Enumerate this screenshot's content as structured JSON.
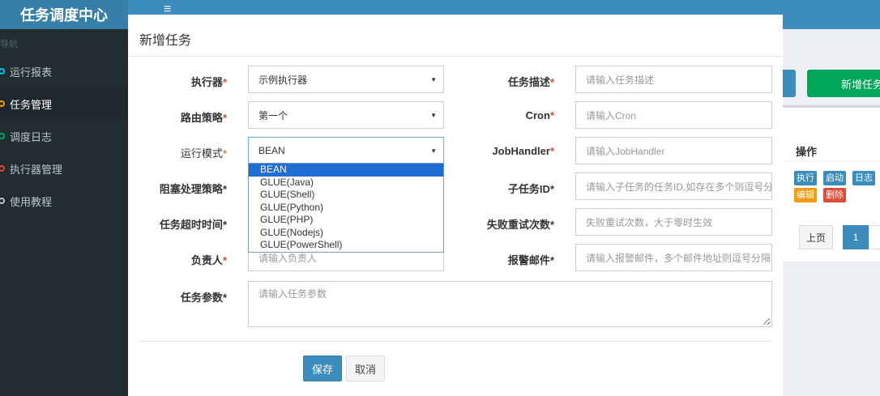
{
  "app": {
    "title": "任务调度中心",
    "menu_icon": "hamburger-icon"
  },
  "sidebar": {
    "header": "导航",
    "items": [
      {
        "label": "运行报表",
        "dot_color": "#00c0ef"
      },
      {
        "label": "任务管理",
        "dot_color": "#f39c12",
        "active": true
      },
      {
        "label": "调度日志",
        "dot_color": "#00a65a"
      },
      {
        "label": "执行器管理",
        "dot_color": "#dd4b39"
      },
      {
        "label": "使用教程",
        "dot_color": "#b8c7ce"
      }
    ]
  },
  "background": {
    "add_task_button": "新增任务",
    "table_header": "操作",
    "row_buttons": [
      "执行",
      "启动",
      "日志",
      "编辑",
      "删除"
    ],
    "pager_prev": "上页",
    "pager_page": "1"
  },
  "modal": {
    "title": "新增任务",
    "required_mark": "*",
    "executor": {
      "label": "执行器",
      "value": "示例执行器"
    },
    "route": {
      "label": "路由策略",
      "value": "第一个"
    },
    "run_mode": {
      "label": "运行模式",
      "value": "BEAN",
      "options": [
        "BEAN",
        "GLUE(Java)",
        "GLUE(Shell)",
        "GLUE(Python)",
        "GLUE(PHP)",
        "GLUE(Nodejs)",
        "GLUE(PowerShell)"
      ],
      "selected_index": 0
    },
    "block_strategy": {
      "label": "阻塞处理策略"
    },
    "timeout": {
      "label": "任务超时时间"
    },
    "owner": {
      "label": "负责人",
      "placeholder": "请输入负责人"
    },
    "task_desc": {
      "label": "任务描述",
      "placeholder": "请输入任务描述"
    },
    "cron": {
      "label": "Cron",
      "placeholder": "请输入Cron"
    },
    "job_handler": {
      "label": "JobHandler",
      "placeholder": "请输入JobHandler"
    },
    "child_id": {
      "label": "子任务ID",
      "placeholder": "请输入子任务的任务ID,如存在多个则逗号分隔"
    },
    "retry": {
      "label": "失败重试次数",
      "placeholder": "失败重试次数，大于零时生效"
    },
    "alarm_email": {
      "label": "报警邮件",
      "placeholder": "请输入报警邮件，多个邮件地址则逗号分隔"
    },
    "params": {
      "label": "任务参数",
      "placeholder": "请输入任务参数"
    },
    "save_label": "保存",
    "cancel_label": "取消"
  }
}
